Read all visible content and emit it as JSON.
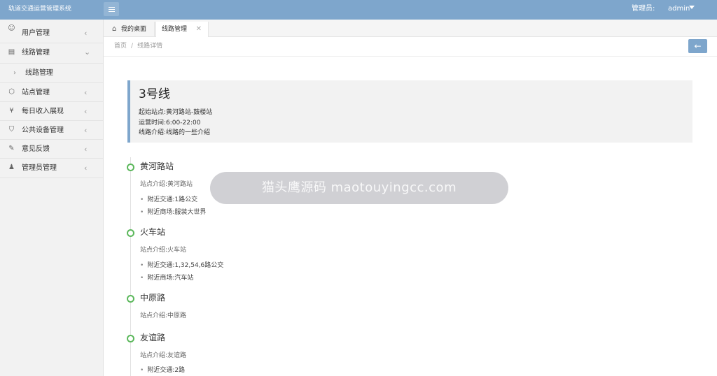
{
  "header": {
    "app_title": "轨道交通运营管理系统",
    "user_label": "管理员:",
    "user_name": "admin"
  },
  "sidebar": {
    "items": [
      {
        "label": "用户管理",
        "icon": "user-icon"
      },
      {
        "label": "线路管理",
        "icon": "route-icon",
        "expanded": true
      },
      {
        "label": "线路管理",
        "icon": "chevron-right-icon",
        "sub": true
      },
      {
        "label": "站点管理",
        "icon": "cube-icon"
      },
      {
        "label": "每日收入展现",
        "icon": "yen-icon"
      },
      {
        "label": "公共设备管理",
        "icon": "shield-icon"
      },
      {
        "label": "意见反馈",
        "icon": "edit-icon"
      },
      {
        "label": "管理员管理",
        "icon": "admin-icon"
      }
    ]
  },
  "tabs": {
    "home": "我的桌面",
    "active": "线路管理"
  },
  "breadcrumb": {
    "home": "首页",
    "separator": "/",
    "current": "线路详情"
  },
  "line": {
    "name": "3号线",
    "stations": "起始站点:黄河路站-鼓楼站",
    "hours": "运营时间:6:00-22:00",
    "intro": "线路介绍:线路的一些介绍"
  },
  "stops": [
    {
      "name": "黄河路站",
      "intro": "站点介绍:黄河路站",
      "details": [
        "附近交通:1路公交",
        "附近商场:服装大世界"
      ]
    },
    {
      "name": "火车站",
      "intro": "站点介绍:火车站",
      "details": [
        "附近交通:1,32,54,6路公交",
        "附近商场:汽车站"
      ]
    },
    {
      "name": "中原路",
      "intro": "站点介绍:中原路",
      "details": []
    },
    {
      "name": "友谊路",
      "intro": "站点介绍:友谊路",
      "details": [
        "附近交通:2路"
      ]
    }
  ],
  "watermark": "猫头鹰源码 maotouyingcc.com",
  "colors": {
    "accent": "#7ea6cc",
    "timeline_dot": "#5cb85c"
  }
}
